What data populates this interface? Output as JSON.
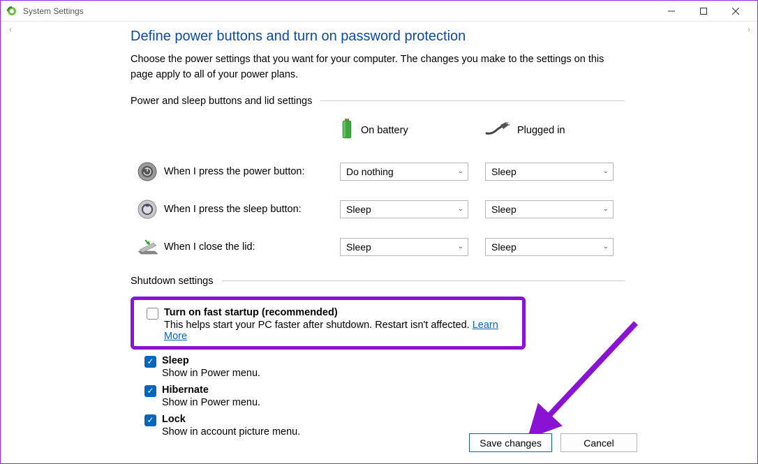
{
  "window": {
    "title": "System Settings"
  },
  "heading": "Define power buttons and turn on password protection",
  "description": "Choose the power settings that you want for your computer. The changes you make to the settings on this page apply to all of your power plans.",
  "section1_label": "Power and sleep buttons and lid settings",
  "col_battery": "On battery",
  "col_plugged": "Plugged in",
  "rows": {
    "power": {
      "label": "When I press the power button:",
      "battery": "Do nothing",
      "plugged": "Sleep"
    },
    "sleep": {
      "label": "When I press the sleep button:",
      "battery": "Sleep",
      "plugged": "Sleep"
    },
    "lid": {
      "label": "When I close the lid:",
      "battery": "Sleep",
      "plugged": "Sleep"
    }
  },
  "section2_label": "Shutdown settings",
  "shutdown": {
    "fast": {
      "title": "Turn on fast startup (recommended)",
      "sub": "This helps start your PC faster after shutdown. Restart isn't affected.",
      "link": "Learn More"
    },
    "sleep": {
      "title": "Sleep",
      "sub": "Show in Power menu."
    },
    "hibernate": {
      "title": "Hibernate",
      "sub": "Show in Power menu."
    },
    "lock": {
      "title": "Lock",
      "sub": "Show in account picture menu."
    }
  },
  "buttons": {
    "save": "Save changes",
    "cancel": "Cancel"
  }
}
